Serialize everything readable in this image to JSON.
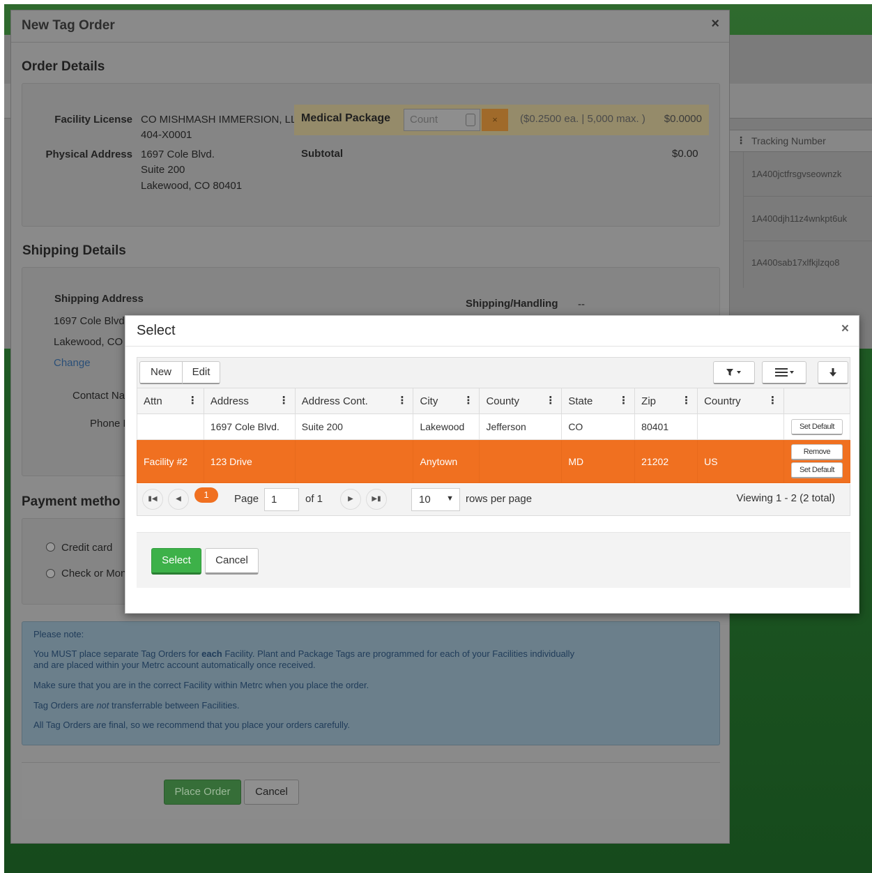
{
  "background": {
    "grid_header": "Tracking Number",
    "tracking_numbers": [
      "1A400jctfrsgvseownzk",
      "1A400djh11z4wnkpt6uk",
      "1A400sab17xlfkjlzqo8"
    ]
  },
  "main_dialog": {
    "title": "New Tag Order",
    "close": "×",
    "order_details": {
      "heading": "Order Details",
      "facility_license_label": "Facility License",
      "facility_name": "CO MISHMASH IMMERSION, LLC",
      "facility_license_number": "404-X0001",
      "physical_address_label": "Physical Address",
      "address_line1": "1697 Cole Blvd.",
      "address_line2": "Suite 200",
      "address_line3": "Lakewood, CO 80401",
      "medical_package_label": "Medical Package",
      "count_placeholder": "Count",
      "clear_button": "×",
      "price_info": "($0.2500 ea. | 5,000 max. )",
      "package_total": "$0.0000",
      "subtotal_label": "Subtotal",
      "subtotal_value": "$0.00"
    },
    "shipping_details": {
      "heading": "Shipping Details",
      "address_label": "Shipping Address",
      "address_line1": "1697 Cole Blvd",
      "address_line2": "Lakewood, CO",
      "change_link": "Change",
      "contact_name_label": "Contact Na",
      "phone_label": "Phone N",
      "shipping_handling_label": "Shipping/Handling",
      "shipping_handling_value": "--"
    },
    "payment": {
      "heading": "Payment metho",
      "option_credit": "Credit card",
      "option_check": "Check or Mon"
    },
    "note": {
      "title": "Please note:",
      "line1_pre": "You MUST place separate Tag Orders for ",
      "line1_bold": "each",
      "line1_post": " Facility. Plant and Package Tags are programmed for each of your Facilities individually",
      "line2": "and are placed within your Metrc account automatically once received.",
      "line3": "Make sure that you are in the correct Facility within Metrc when you place the order.",
      "line4_pre": "Tag Orders are ",
      "line4_em": "not",
      "line4_post": " transferrable between Facilities.",
      "line5": "All Tag Orders are final, so we recommend that you place your orders carefully."
    },
    "buttons": {
      "place_order": "Place Order",
      "cancel": "Cancel"
    }
  },
  "select_dialog": {
    "title": "Select",
    "close": "×",
    "toolbar": {
      "new": "New",
      "edit": "Edit"
    },
    "columns": [
      "Attn",
      "Address",
      "Address Cont.",
      "City",
      "County",
      "State",
      "Zip",
      "Country"
    ],
    "rows": [
      {
        "attn": "",
        "address": "1697 Cole Blvd.",
        "address_cont": "Suite 200",
        "city": "Lakewood",
        "county": "Jefferson",
        "state": "CO",
        "zip": "80401",
        "country": "",
        "actions": [
          "Set Default"
        ]
      },
      {
        "attn": "Facility #2",
        "address": "123 Drive",
        "address_cont": "",
        "city": "Anytown",
        "county": "",
        "state": "MD",
        "zip": "21202",
        "country": "US",
        "actions": [
          "Remove",
          "Set Default"
        ]
      }
    ],
    "pager": {
      "current_page_badge": "1",
      "page_label": "Page",
      "page_value": "1",
      "of_label": "of 1",
      "rows_per_page_value": "10",
      "rows_per_page_label": "rows per page",
      "viewing": "Viewing 1 - 2 (2 total)"
    },
    "buttons": {
      "select": "Select",
      "cancel": "Cancel"
    }
  },
  "colors": {
    "accent_orange": "#f07020",
    "select_green": "#3db149"
  }
}
